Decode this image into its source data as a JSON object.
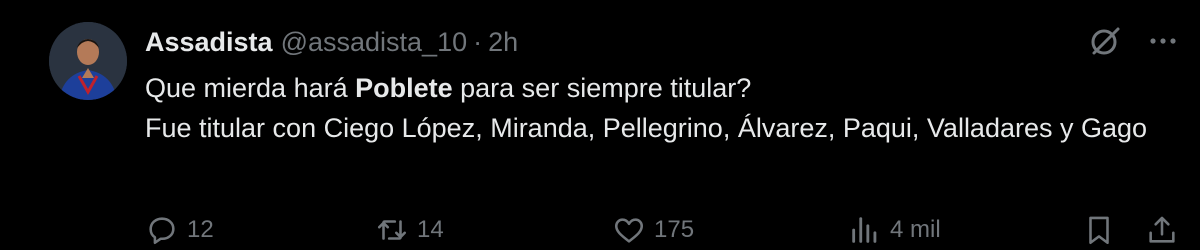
{
  "tweet": {
    "author_name": "Assadista",
    "handle": "@assadista_10",
    "separator": "·",
    "time": "2h",
    "text": {
      "line1_before": "Que mierda hará ",
      "line1_bold": "Poblete",
      "line1_after": " para ser siempre titular?",
      "line2": "Fue titular con Ciego López, Miranda, Pellegrino, Álvarez, Paqui, Valladares y Gago"
    }
  },
  "actions": {
    "replies": "12",
    "reposts": "14",
    "likes": "175",
    "views": "4 mil"
  },
  "icons": {
    "top": [
      "grok-icon",
      "more-icon"
    ],
    "actions": [
      "reply-icon",
      "repost-icon",
      "like-icon",
      "views-icon",
      "bookmark-icon",
      "share-icon"
    ]
  },
  "colors": {
    "background": "#000000",
    "text": "#e7e9ea",
    "muted": "#71767b"
  }
}
